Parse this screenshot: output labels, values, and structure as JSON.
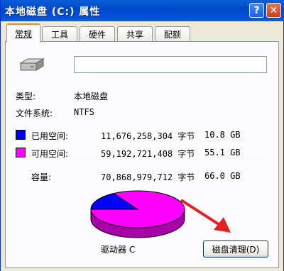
{
  "window": {
    "title": "本地磁盘 (C:) 属性",
    "help_glyph": "?",
    "close_glyph": "✕"
  },
  "tabs": [
    {
      "label": "常规",
      "active": true
    },
    {
      "label": "工具",
      "active": false
    },
    {
      "label": "硬件",
      "active": false
    },
    {
      "label": "共享",
      "active": false
    },
    {
      "label": "配额",
      "active": false
    }
  ],
  "general": {
    "drive_icon": "hard-drive-icon",
    "volume_name_value": "",
    "type_label": "类型:",
    "type_value": "本地磁盘",
    "fs_label": "文件系统:",
    "fs_value": "NTFS",
    "used": {
      "label": "已用空间:",
      "bytes": "11,676,258,304 字节",
      "size": "10.8 GB",
      "color": "#0000ff"
    },
    "free": {
      "label": "可用空间:",
      "bytes": "59,192,721,408 字节",
      "size": "55.1 GB",
      "color": "#ff00ff"
    },
    "capacity": {
      "label": "容量:",
      "bytes": "70,868,979,712 字节",
      "size": "66.0 GB"
    },
    "drive_label": "驱动器 C",
    "cleanup_button": "磁盘清理(D)",
    "used_fraction": 0.1648
  }
}
